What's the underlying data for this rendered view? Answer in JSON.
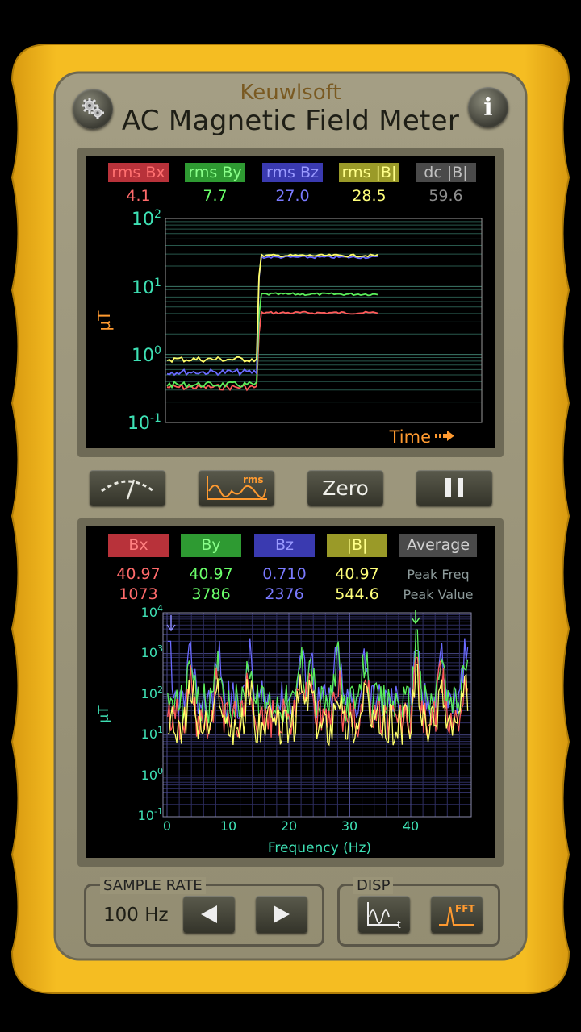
{
  "app": {
    "brand": "Keuwlsoft",
    "title": "AC Magnetic Field Meter",
    "settings_icon": "gears-icon",
    "info_icon": "info-icon",
    "info_label": "i"
  },
  "top_panel": {
    "channels": [
      {
        "label": "rms Bx",
        "value": "4.1",
        "bg": "#b8323a",
        "fg": "#ff6a6a"
      },
      {
        "label": "rms By",
        "value": "7.7",
        "bg": "#2e9a32",
        "fg": "#6aff6a"
      },
      {
        "label": "rms Bz",
        "value": "27.0",
        "bg": "#3a3ab0",
        "fg": "#7a7aff"
      },
      {
        "label": "rms |B|",
        "value": "28.5",
        "bg": "#9a9a28",
        "fg": "#ffff7a"
      },
      {
        "label": "dc |B|",
        "value": "59.6",
        "bg": "#4a4a4a",
        "fg": "#8c8c8c"
      }
    ],
    "ylabel": "µT",
    "y_ticks": [
      "10",
      "10",
      "10",
      "10"
    ],
    "y_exps": [
      "2",
      "1",
      "0",
      "-1"
    ],
    "xlabel": "Time"
  },
  "controls": {
    "meter_icon": "analog-meter-icon",
    "rms_icon": "rms-graph-icon",
    "rms_text": "rms",
    "zero_label": "Zero",
    "pause_icon": "pause-icon"
  },
  "bottom_panel": {
    "channels": [
      {
        "label": "Bx",
        "peak_freq": "40.97",
        "peak_value": "1073",
        "bg": "#b8323a",
        "fg": "#ff6a6a"
      },
      {
        "label": "By",
        "peak_freq": "40.97",
        "peak_value": "3786",
        "bg": "#2e9a32",
        "fg": "#6aff6a"
      },
      {
        "label": "Bz",
        "peak_freq": "0.710",
        "peak_value": "2376",
        "bg": "#3a3ab0",
        "fg": "#7a7aff"
      },
      {
        "label": "|B|",
        "peak_freq": "40.97",
        "peak_value": "544.6",
        "bg": "#9a9a28",
        "fg": "#ffff7a"
      }
    ],
    "average_label": "Average",
    "peak_freq_label": "Peak Freq",
    "peak_value_label": "Peak Value",
    "ylabel": "µT",
    "y_ticks": [
      "10",
      "10",
      "10",
      "10",
      "10",
      "10"
    ],
    "y_exps": [
      "4",
      "3",
      "2",
      "1",
      "0",
      "-1"
    ],
    "x_ticks": [
      "0",
      "10",
      "20",
      "30",
      "40"
    ],
    "xlabel": "Frequency (Hz)"
  },
  "footer": {
    "sample_rate_title": "SAMPLE RATE",
    "sample_rate_value": "100 Hz",
    "prev_icon": "arrow-left-icon",
    "next_icon": "arrow-right-icon",
    "disp_title": "DISP",
    "time_mode_icon": "time-graph-icon",
    "fft_mode_icon": "fft-graph-icon",
    "fft_text": "FFT"
  },
  "colors": {
    "case_yellow": "#f2b71c",
    "faceplate": "#9a9478",
    "red": "#ff5a5a",
    "green": "#5aee5a",
    "blue": "#6a6aff",
    "yellow": "#ffff6a",
    "cyan": "#3ee0b4",
    "orange": "#ff9a30"
  }
}
